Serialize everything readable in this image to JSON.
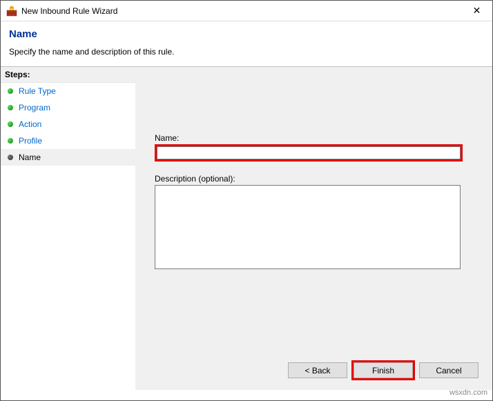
{
  "titlebar": {
    "title": "New Inbound Rule Wizard"
  },
  "header": {
    "title": "Name",
    "description": "Specify the name and description of this rule."
  },
  "sidebar": {
    "steps_label": "Steps:",
    "items": [
      {
        "label": "Rule Type",
        "state": "done"
      },
      {
        "label": "Program",
        "state": "done"
      },
      {
        "label": "Action",
        "state": "done"
      },
      {
        "label": "Profile",
        "state": "done"
      },
      {
        "label": "Name",
        "state": "current"
      }
    ]
  },
  "form": {
    "name_label": "Name:",
    "name_value": "",
    "desc_label": "Description (optional):",
    "desc_value": ""
  },
  "buttons": {
    "back": "< Back",
    "finish": "Finish",
    "cancel": "Cancel"
  },
  "watermark": "wsxdn.com"
}
